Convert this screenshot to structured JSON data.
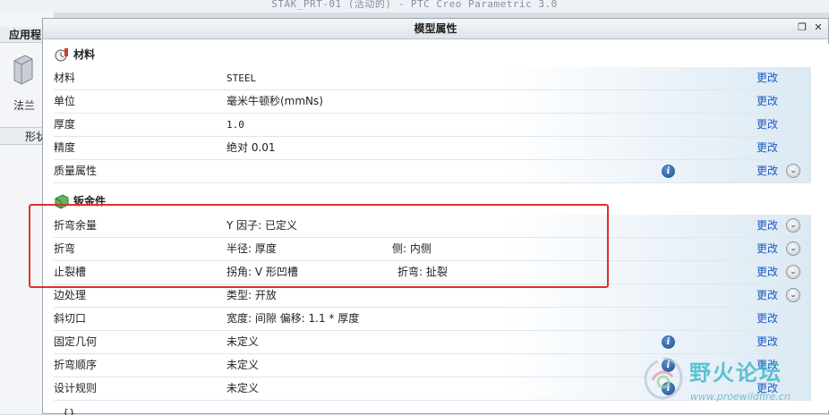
{
  "app": {
    "title": "STAK_PRT-01 (活动的) - PTC Creo Parametric 3.0",
    "ribbon_tab": "应用程",
    "flange_label": "法兰",
    "shape_tab": "形状"
  },
  "dialog": {
    "title": "模型属性",
    "restore_glyph": "❐",
    "close_glyph": "✕"
  },
  "sections": {
    "material": {
      "label": "材料",
      "rows": [
        {
          "name": "材料",
          "value": "STEEL",
          "change": "更改"
        },
        {
          "name": "单位",
          "value": "毫米牛顿秒(mmNs)",
          "change": "更改"
        },
        {
          "name": "厚度",
          "value": "1.0",
          "change": "更改"
        },
        {
          "name": "精度",
          "value": "绝对 0.01",
          "change": "更改"
        },
        {
          "name": "质量属性",
          "value": "",
          "change": "更改",
          "info": "i"
        }
      ]
    },
    "sheetmetal": {
      "label": "钣金件",
      "rows": [
        {
          "name": "折弯余量",
          "value": "Y 因子: 已定义",
          "value2": "",
          "change": "更改"
        },
        {
          "name": "折弯",
          "value": "半径: 厚度",
          "value2": "侧: 内侧",
          "change": "更改"
        },
        {
          "name": "止裂槽",
          "value": "拐角: V 形凹槽",
          "value2": "折弯: 扯裂",
          "change": "更改"
        },
        {
          "name": "边处理",
          "value": "类型: 开放",
          "value2": "",
          "change": "更改"
        },
        {
          "name": "斜切口",
          "value": "宽度: 间隙 偏移: 1.1 * 厚度",
          "value2": "",
          "change": "更改"
        },
        {
          "name": "固定几何",
          "value": "未定义",
          "value2": "",
          "change": "更改",
          "info": "i"
        },
        {
          "name": "折弯顺序",
          "value": "未定义",
          "value2": "",
          "change": "更改",
          "info": "i"
        },
        {
          "name": "设计规则",
          "value": "未定义",
          "value2": "",
          "change": "更改",
          "info": "i"
        }
      ]
    }
  },
  "bottom_text": "{}",
  "watermark": {
    "text": "野火论坛",
    "url": "www.proewildfire.cn"
  },
  "colors": {
    "link": "#1f58c4",
    "highlight_box": "#e0302a"
  }
}
